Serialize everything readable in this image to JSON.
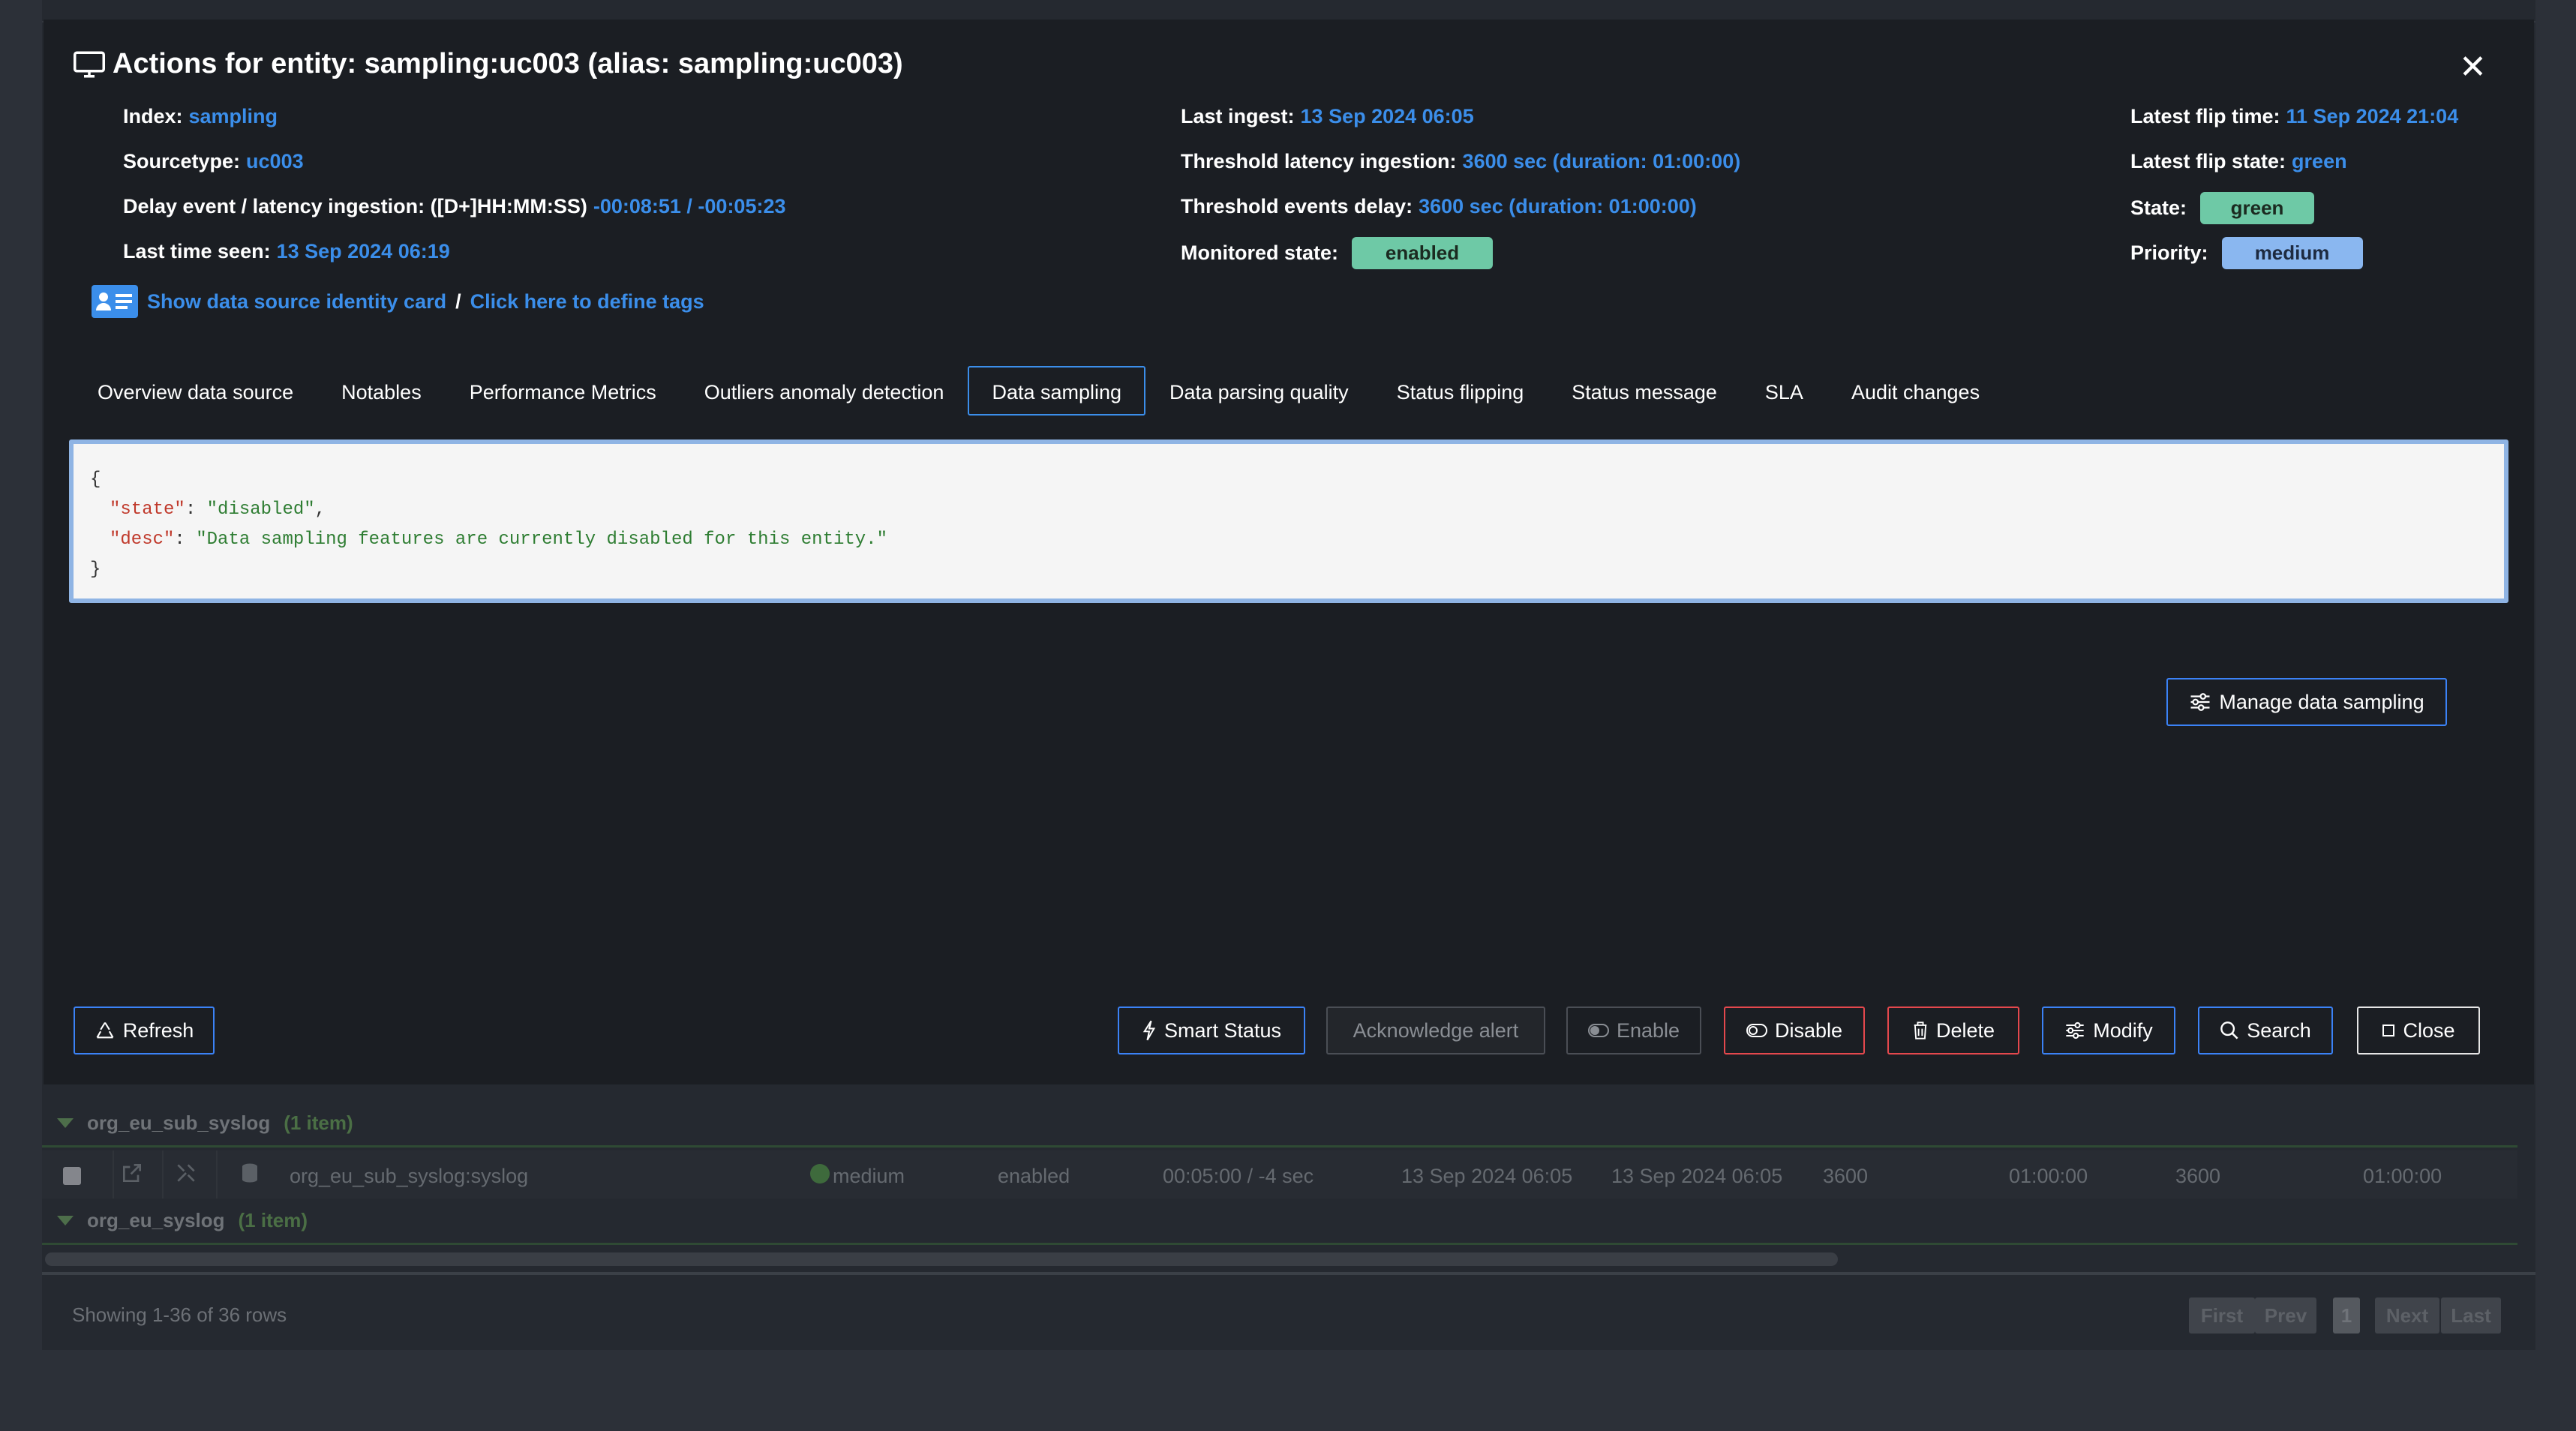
{
  "background": {
    "groups": [
      {
        "name": "org_eu_sub_syslog",
        "count": "(1 item)"
      },
      {
        "name": "org_eu_syslog",
        "count": "(1 item)"
      }
    ],
    "row": {
      "name": "org_eu_sub_syslog:syslog",
      "priority": "medium",
      "state": "enabled",
      "delay": "00:05:00 / -4 sec",
      "last_time": "13 Sep 2024 06:05",
      "last_ingest": "13 Sep 2024 06:05",
      "threshold_1": "3600",
      "duration_1": "01:00:00",
      "threshold_2": "3600",
      "duration_2": "01:00:00"
    },
    "footer": "Showing 1-36 of 36 rows",
    "pager": {
      "first": "First",
      "prev": "Prev",
      "page": "1",
      "next": "Next",
      "last": "Last"
    }
  },
  "modal": {
    "title": "Actions for entity: sampling:uc003 (alias: sampling:uc003)",
    "col1": {
      "index_label": "Index:",
      "index_value": "sampling",
      "sourcetype_label": "Sourcetype:",
      "sourcetype_value": "uc003",
      "delay_label": "Delay event / latency ingestion: ([D+]HH:MM:SS)",
      "delay_value": "-00:08:51 / -00:05:23",
      "lastseen_label": "Last time seen:",
      "lastseen_value": "13 Sep 2024 06:19"
    },
    "col2": {
      "lastingest_label": "Last ingest:",
      "lastingest_value": "13 Sep 2024 06:05",
      "thr_latency_label": "Threshold latency ingestion:",
      "thr_latency_value": "3600 sec (duration: 01:00:00)",
      "thr_delay_label": "Threshold events delay:",
      "thr_delay_value": "3600 sec (duration: 01:00:00)",
      "monitored_label": "Monitored state:",
      "monitored_value": "enabled"
    },
    "col3": {
      "flip_time_label": "Latest flip time:",
      "flip_time_value": "11 Sep 2024 21:04",
      "flip_state_label": "Latest flip state:",
      "flip_state_value": "green",
      "state_label": "State:",
      "state_value": "green",
      "priority_label": "Priority:",
      "priority_value": "medium"
    },
    "links": {
      "identity_card": "Show data source identity card",
      "separator": "/",
      "define_tags": "Click here to define tags"
    },
    "tabs": [
      {
        "label": "Overview data source",
        "active": false
      },
      {
        "label": "Notables",
        "active": false
      },
      {
        "label": "Performance Metrics",
        "active": false
      },
      {
        "label": "Outliers anomaly detection",
        "active": false
      },
      {
        "label": "Data sampling",
        "active": true
      },
      {
        "label": "Data parsing quality",
        "active": false
      },
      {
        "label": "Status flipping",
        "active": false
      },
      {
        "label": "Status message",
        "active": false
      },
      {
        "label": "SLA",
        "active": false
      },
      {
        "label": "Audit changes",
        "active": false
      }
    ],
    "code": {
      "open": "{",
      "state_key": "\"state\"",
      "state_val": "\"disabled\"",
      "desc_key": "\"desc\"",
      "desc_val": "\"Data sampling features are currently disabled for this entity.\"",
      "close": "}"
    },
    "manage_button": "Manage data sampling",
    "buttons": {
      "refresh": "Refresh",
      "smart_status": "Smart Status",
      "acknowledge": "Acknowledge alert",
      "enable": "Enable",
      "disable": "Disable",
      "delete": "Delete",
      "modify": "Modify",
      "search": "Search",
      "close": "Close"
    }
  },
  "colors": {
    "accent": "#3b8eea",
    "state_green": "#6ec9a6",
    "priority_blue": "#8ab7f0",
    "danger": "#e5484d"
  }
}
